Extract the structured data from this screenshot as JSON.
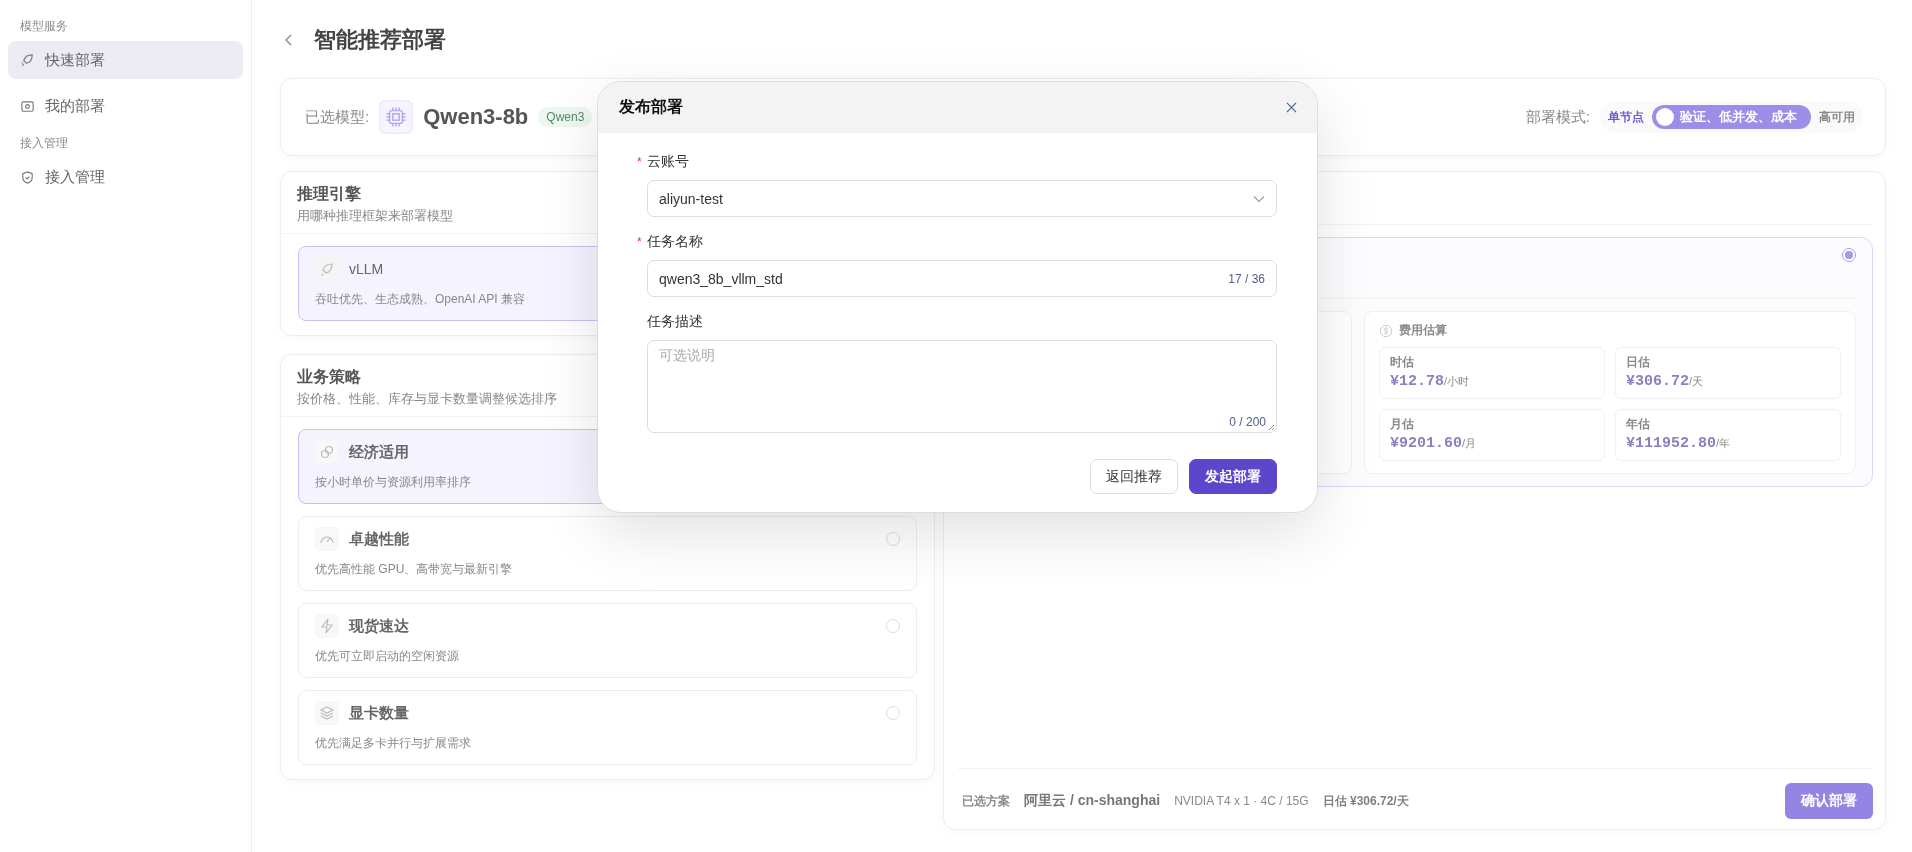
{
  "sidebar": {
    "sections": [
      {
        "title": "模型服务",
        "items": [
          {
            "label": "快速部署",
            "selected": true
          },
          {
            "label": "我的部署",
            "selected": false
          }
        ]
      },
      {
        "title": "接入管理",
        "items": [
          {
            "label": "接入管理",
            "selected": false
          }
        ]
      }
    ]
  },
  "page": {
    "title": "智能推荐部署"
  },
  "model_bar": {
    "label": "已选模型:",
    "name": "Qwen3-8b",
    "tag": "Qwen3",
    "mode_label": "部署模式:",
    "mode_options": [
      {
        "label": "单节点",
        "selected": true
      },
      {
        "label": "高可用",
        "selected": false
      }
    ],
    "mode_switch": {
      "text": "验证、低并发、成本",
      "on": false
    }
  },
  "engine_card": {
    "title": "推理引擎",
    "subtitle": "用哪种推理框架来部署模型",
    "options": [
      {
        "name": "vLLM",
        "description": "吞吐优先、生态成熟、OpenAI API 兼容",
        "selected": true
      }
    ]
  },
  "strategy_card": {
    "title": "业务策略",
    "subtitle": "按价格、性能、库存与显卡数量调整候选排序",
    "options": [
      {
        "name": "经济适用",
        "description": "按小时单价与资源利用率排序",
        "selected": true
      },
      {
        "name": "卓越性能",
        "description": "优先高性能 GPU、高带宽与最新引擎",
        "selected": false
      },
      {
        "name": "现货速达",
        "description": "优先可立即启动的空闲资源",
        "selected": false
      },
      {
        "name": "显卡数量",
        "description": "优先满足多卡并行与扩展需求",
        "selected": false
      }
    ]
  },
  "plan_card": {
    "selected": true,
    "cost": {
      "title": "费用估算",
      "items": [
        {
          "label": "时估",
          "value": "¥12.78",
          "unit": "/小时"
        },
        {
          "label": "日估",
          "value": "¥306.72",
          "unit": "/天"
        },
        {
          "label": "月估",
          "value": "¥9201.60",
          "unit": "/月"
        },
        {
          "label": "年估",
          "value": "¥111952.80",
          "unit": "/年"
        }
      ]
    }
  },
  "footer": {
    "label": "已选方案",
    "provider": "阿里云 / cn-shanghai",
    "spec": "NVIDIA T4 x 1 · 4C / 15G",
    "daily": "日估 ¥306.72/天",
    "button": "确认部署"
  },
  "dialog": {
    "title": "发布部署",
    "required_mark": "*",
    "fields": [
      {
        "kind": "select",
        "label": "云账号",
        "required": true,
        "value": "aliyun-test"
      },
      {
        "kind": "text",
        "label": "任务名称",
        "required": true,
        "value": "qwen3_8b_vllm_std",
        "counter": "17 / 36"
      },
      {
        "kind": "textarea",
        "label": "任务描述",
        "required": false,
        "placeholder": "可选说明",
        "counter": "0 / 200"
      }
    ],
    "buttons": [
      {
        "label": "返回推荐",
        "kind": "secondary"
      },
      {
        "label": "发起部署",
        "kind": "primary"
      }
    ]
  }
}
